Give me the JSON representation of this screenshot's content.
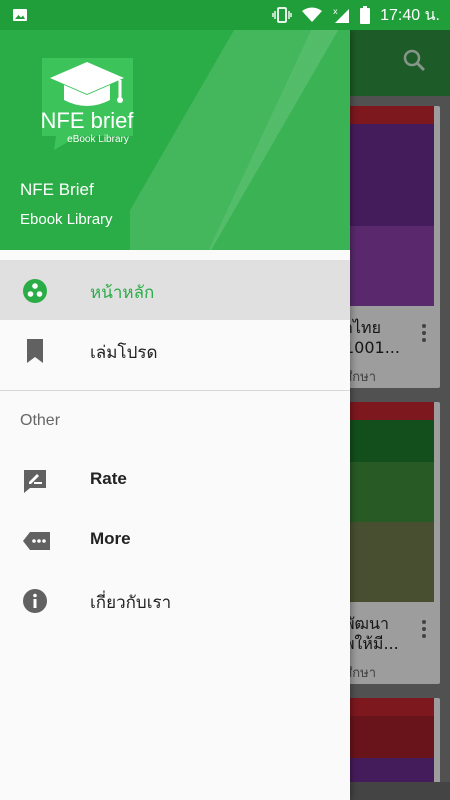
{
  "status_bar": {
    "time": "17:40 น.",
    "icons": [
      "image-icon",
      "vibrate-icon",
      "wifi-icon",
      "signal-icon",
      "battery-icon"
    ]
  },
  "drawer": {
    "header": {
      "logo_title": "NFE brief",
      "logo_sub": "eBook Library",
      "app_name": "NFE Brief",
      "app_subtitle": "Ebook Library",
      "color": "#2aad47"
    },
    "items": [
      {
        "label": "หน้าหลัก",
        "icon": "home-circles-icon",
        "active": true
      },
      {
        "label": "เล่มโปรด",
        "icon": "bookmark-icon",
        "active": false
      }
    ],
    "section_title": "Other",
    "other_items": [
      {
        "label": "Rate",
        "icon": "rate-edit-icon"
      },
      {
        "label": "More",
        "icon": "more-tag-icon"
      },
      {
        "label": "เกี่ยวกับเรา",
        "icon": "info-icon"
      }
    ]
  },
  "background": {
    "cards": [
      {
        "title_line1": "าไทย",
        "title_line2": "1001...",
        "author": "ศึกษา"
      },
      {
        "title_line1": "พัฒนา",
        "title_line2": "พให้มี...",
        "author": "ศึกษา"
      }
    ]
  },
  "colors": {
    "accent": "#2aad47",
    "status_bar": "#1f9e3a"
  }
}
